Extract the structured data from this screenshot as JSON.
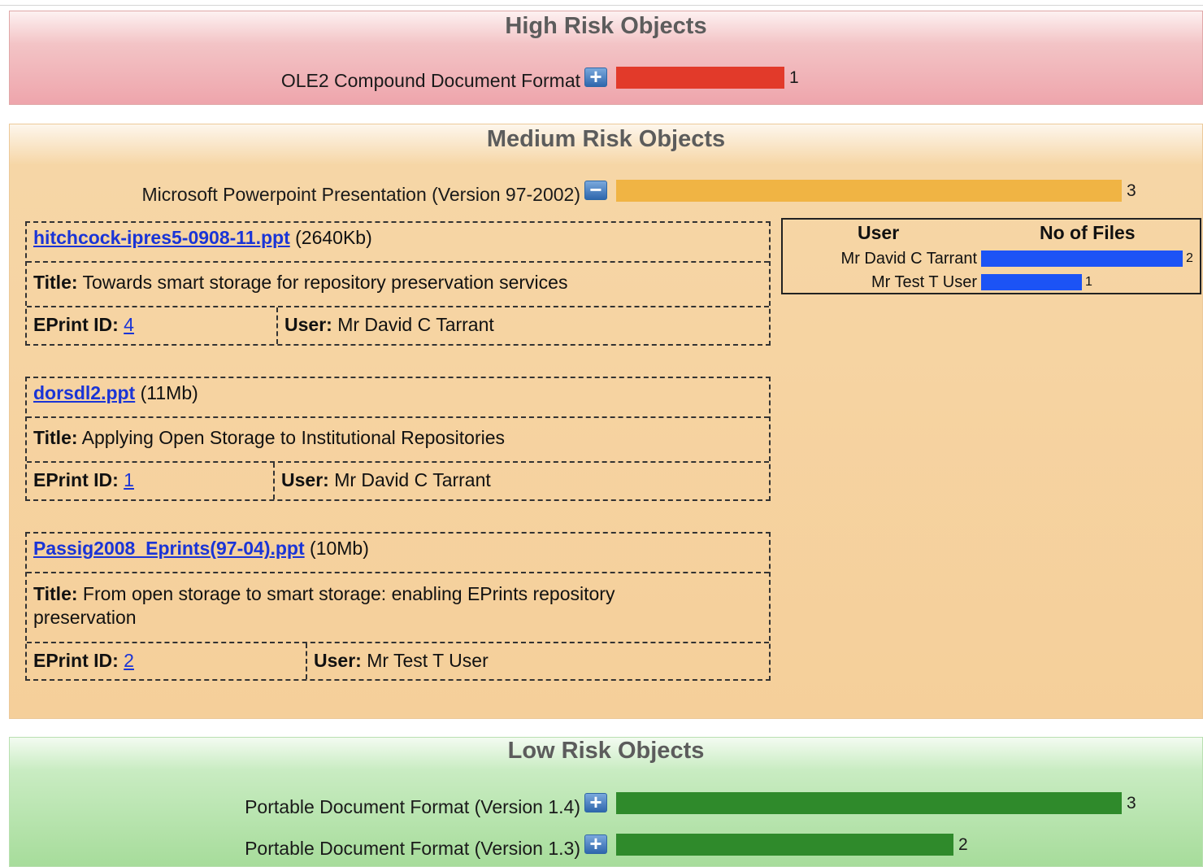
{
  "colors": {
    "high_bar": "#e23a2a",
    "medium_bar": "#f0b444",
    "low_bar": "#2f8a2b",
    "user_bar": "#1c53f5"
  },
  "high": {
    "title": "High Risk Objects",
    "rows": [
      {
        "label": "OLE2 Compound Document Format",
        "toggle": "+",
        "toggle_icon": "expand-icon",
        "count": "1",
        "fraction": 0.333
      }
    ]
  },
  "medium": {
    "title": "Medium Risk Objects",
    "rows": [
      {
        "label": "Microsoft Powerpoint Presentation (Version 97-2002)",
        "toggle": "−",
        "toggle_icon": "collapse-icon",
        "count": "3",
        "fraction": 1.0
      }
    ],
    "files": [
      {
        "name": "hitchcock-ipres5-0908-11.ppt",
        "size": "(2640Kb)",
        "title_label": "Title:",
        "title": "Towards smart storage for repository preservation services",
        "eprint_label": "EPrint ID:",
        "eprint_id": "4",
        "user_label": "User:",
        "user": "Mr David C Tarrant"
      },
      {
        "name": "dorsdl2.ppt",
        "size": "(11Mb)",
        "title_label": "Title:",
        "title": "Applying Open Storage to Institutional Repositories",
        "eprint_label": "EPrint ID:",
        "eprint_id": "1",
        "user_label": "User:",
        "user": "Mr David C Tarrant"
      },
      {
        "name": "Passig2008_Eprints(97-04).ppt",
        "size": "(10Mb)",
        "title_label": "Title:",
        "title": "From open storage to smart storage: enabling EPrints repository preservation",
        "eprint_label": "EPrint ID:",
        "eprint_id": "2",
        "user_label": "User:",
        "user": "Mr Test T User"
      }
    ],
    "users_table": {
      "headers": {
        "user": "User",
        "files": "No of Files"
      },
      "rows": [
        {
          "user": "Mr David C Tarrant",
          "files": "2",
          "fraction": 1.0
        },
        {
          "user": "Mr Test T User",
          "files": "1",
          "fraction": 0.5
        }
      ]
    }
  },
  "low": {
    "title": "Low Risk Objects",
    "rows": [
      {
        "label": "Portable Document Format (Version 1.4)",
        "toggle": "+",
        "toggle_icon": "expand-icon",
        "count": "3",
        "fraction": 1.0
      },
      {
        "label": "Portable Document Format (Version 1.3)",
        "toggle": "+",
        "toggle_icon": "expand-icon",
        "count": "2",
        "fraction": 0.667
      }
    ]
  }
}
